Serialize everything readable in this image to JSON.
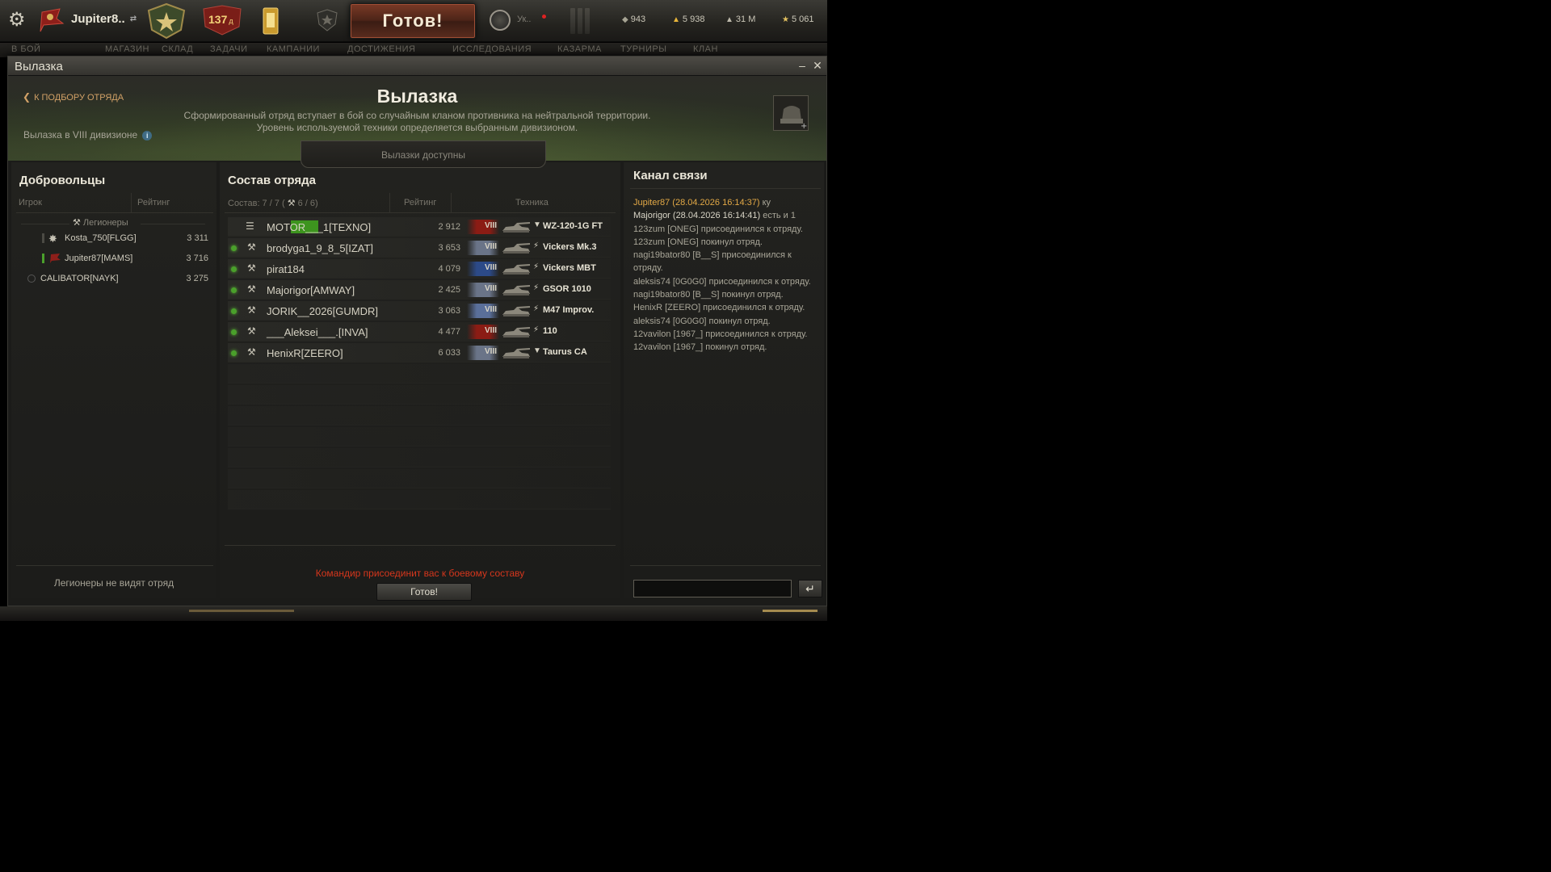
{
  "topbar": {
    "player_name": "Jupiter8..",
    "premium_days": "137",
    "premium_days_suffix": "д",
    "battle_button": "Готов!",
    "tank_short": "Ук..",
    "currencies": [
      {
        "icon": "bonds-icon",
        "value": "943"
      },
      {
        "icon": "gold-icon",
        "value": "5 938"
      },
      {
        "icon": "credits-icon",
        "value": "31 M"
      },
      {
        "icon": "free-xp-icon",
        "value": "5 061"
      }
    ]
  },
  "menu_strip": [
    "В БОЙ",
    "МАГАЗИН",
    "СКЛАД",
    "ЗАДАЧИ",
    "КАМПАНИИ",
    "ДОСТИЖЕНИЯ",
    "ИССЛЕДОВАНИЯ",
    "КАЗАРМА",
    "ТУРНИРЫ",
    "КЛАН"
  ],
  "window": {
    "title": "Вылазка",
    "minimize": "–",
    "close": "✕"
  },
  "header": {
    "back_label": "К ПОДБОРУ ОТРЯДА",
    "title": "Вылазка",
    "desc_line1": "Сформированный отряд вступает в бой со случайным кланом противника на нейтральной территории.",
    "desc_line2": "Уровень используемой техники определяется выбранным дивизионом.",
    "division": "Вылазка в VIII дивизионе",
    "availability": "Вылазки доступны"
  },
  "volunteers": {
    "title": "Добровольцы",
    "col_player": "Игрок",
    "col_rating": "Рейтинг",
    "group_label": "Легионеры",
    "rows": [
      {
        "name": "Kosta_750[FLGG]",
        "rating": "3 311"
      },
      {
        "name": "Jupiter87[MAMS]",
        "rating": "3 716"
      },
      {
        "name": "CALIBATOR[NAYK]",
        "rating": "3 275"
      }
    ],
    "note": "Легионеры не видят отряд"
  },
  "squad": {
    "title": "Состав отряда",
    "composition": "Состав: 7 / 7 (",
    "legion_count": "6 / 6)",
    "col_rating": "Рейтинг",
    "col_vehicle": "Техника",
    "rows": [
      {
        "name": "MOTOR___1[TEXNO]",
        "rating": "2 912",
        "tier": "VIII",
        "class": "▼",
        "tank": "WZ-120-1G FT",
        "nation_color": "#8b1c14"
      },
      {
        "name": "brodyga1_9_8_5[IZAT]",
        "rating": "3 653",
        "tier": "VIII",
        "class": "⚡",
        "tank": "Vickers Mk.3",
        "nation_color": "#6a7488"
      },
      {
        "name": "pirat184",
        "rating": "4 079",
        "tier": "VIII",
        "class": "⚡",
        "tank": "Vickers MBT",
        "nation_color": "#2c4a88"
      },
      {
        "name": "Majorigor[AMWAY]",
        "rating": "2 425",
        "tier": "VIII",
        "class": "⚡",
        "tank": "GSOR 1010",
        "nation_color": "#6a7488"
      },
      {
        "name": "JORIK__2026[GUMDR]",
        "rating": "3 063",
        "tier": "VIII",
        "class": "⚡",
        "tank": "M47 Improv.",
        "nation_color": "#5a6f9a"
      },
      {
        "name": "___Aleksei___.[INVA]",
        "rating": "4 477",
        "tier": "VIII",
        "class": "⚡",
        "tank": "110",
        "nation_color": "#8b1c14"
      },
      {
        "name": "HenixR[ZEERO]",
        "rating": "6 033",
        "tier": "VIII",
        "class": "▼",
        "tank": "Taurus CA",
        "nation_color": "#6a7488"
      }
    ],
    "commander_msg": "Командир присоединит вас к боевому составу",
    "ready_button": "Готов!"
  },
  "chat": {
    "title": "Канал связи",
    "messages": [
      {
        "type": "own",
        "from": "Jupiter87 (28.04.2026 16:14:37)",
        "text": " ку"
      },
      {
        "type": "other",
        "from": "Majorigor (28.04.2026 16:14:41)",
        "text": " есть и 1"
      },
      {
        "type": "sys",
        "from": "",
        "text": "123zum [ONEG] присоединился к отряду."
      },
      {
        "type": "sys",
        "from": "",
        "text": "123zum [ONEG] покинул отряд."
      },
      {
        "type": "sys",
        "from": "",
        "text": "nagi19bator80 [B__S] присоединился к отряду."
      },
      {
        "type": "sys",
        "from": "",
        "text": "aleksis74 [0G0G0] присоединился к отряду."
      },
      {
        "type": "sys",
        "from": "",
        "text": "nagi19bator80 [B__S] покинул отряд."
      },
      {
        "type": "sys",
        "from": "",
        "text": "HenixR [ZEERO] присоединился к отряду."
      },
      {
        "type": "sys",
        "from": "",
        "text": "aleksis74 [0G0G0] покинул отряд."
      },
      {
        "type": "sys",
        "from": "",
        "text": "12vavilon [1967_] присоединился к отряду."
      },
      {
        "type": "sys",
        "from": "",
        "text": "12vavilon [1967_] покинул отряд."
      }
    ],
    "input_value": "",
    "send_label": "↵"
  }
}
